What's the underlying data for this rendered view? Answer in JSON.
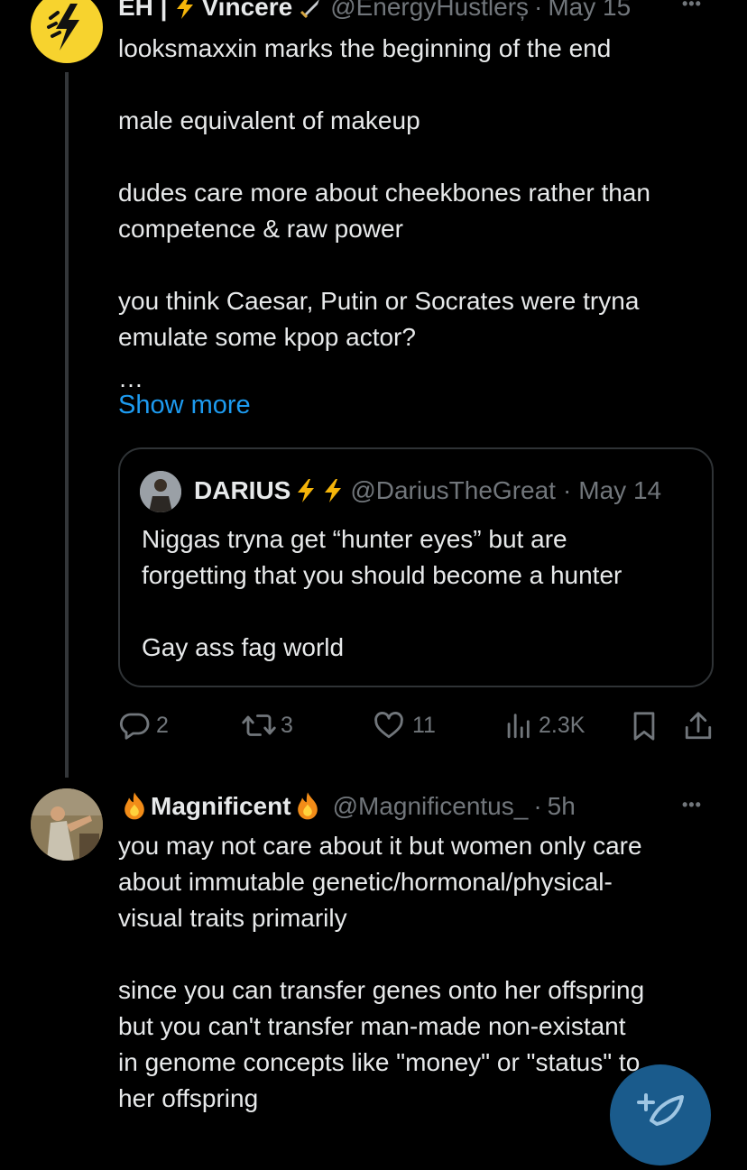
{
  "post1": {
    "name": "EH |",
    "name_suffix": "Vincere",
    "handle": "@EnergyHustlerș",
    "dot": "·",
    "time": "May 15",
    "more": "•••",
    "text": "looksmaxxin marks the beginning of the end\n\nmale equivalent of makeup\n\ndudes care more about cheekbones rather than\ncompetence & raw power\n\nyou think Caesar, Putin or Socrates were tryna\nemulate some kpop actor?",
    "ellipsis": "…",
    "show_more": "Show more",
    "quote": {
      "name": "DARIUS",
      "handle": "@DariusTheGreat",
      "dot": "·",
      "time": "May 14",
      "text": "Niggas tryna get “hunter eyes” but are\nforgetting that you should become a hunter\n\nGay ass fag world"
    },
    "actions": {
      "replies": "2",
      "reposts": "3",
      "likes": "11",
      "views": "2.3K"
    }
  },
  "post2": {
    "name": "Magnificent",
    "handle": "@Magnificentus_",
    "dot": "·",
    "time": "5h",
    "more": "•••",
    "text": "you may not care about it but women only care\nabout immutable genetic/hormonal/physical-\nvisual traits primarily\n\nsince you can transfer genes onto her offspring\nbut you can't transfer man-made non-existant\nin genome concepts like \"money\" or \"status\" to\nher offspring"
  },
  "colors": {
    "accent": "#1d9bf0",
    "muted": "#71767b",
    "text": "#e7e9ea",
    "lightning": "#f5b50a"
  },
  "icons": [
    "lightning-icon",
    "dagger-icon",
    "fire-icon",
    "reply-icon",
    "repost-icon",
    "like-icon",
    "views-icon",
    "bookmark-icon",
    "share-icon",
    "compose-icon"
  ]
}
